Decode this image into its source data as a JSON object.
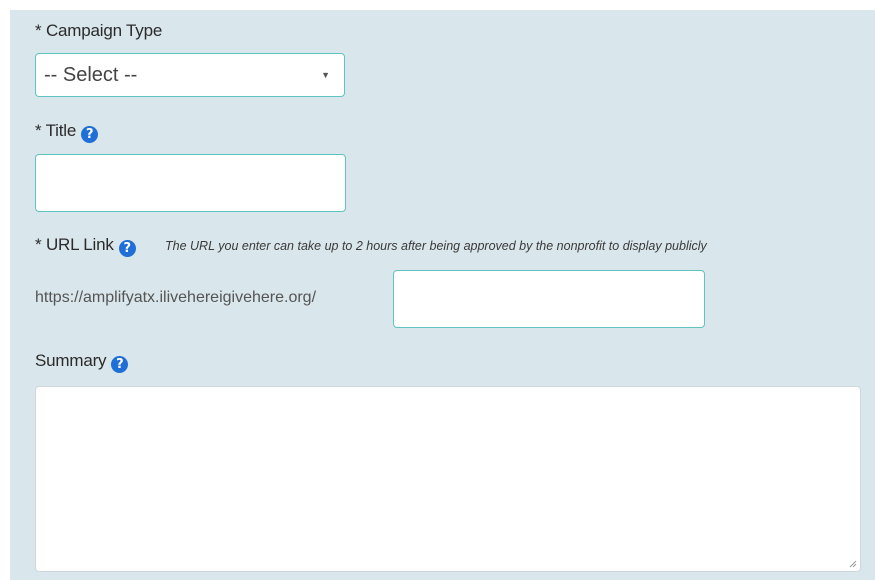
{
  "form": {
    "campaign_type": {
      "label": "* Campaign Type",
      "selected": "-- Select --"
    },
    "title": {
      "label": "* Title",
      "help_icon": "question-circle-icon",
      "help_glyph": "?",
      "value": ""
    },
    "url_link": {
      "label": "* URL Link",
      "help_icon": "question-circle-icon",
      "help_glyph": "?",
      "hint": "The URL you enter can take up to 2 hours after being approved by the nonprofit to display publicly",
      "prefix": "https://amplifyatx.ilivehereigivehere.org/",
      "value": ""
    },
    "summary": {
      "label": "Summary",
      "help_icon": "question-circle-icon",
      "help_glyph": "?",
      "value": ""
    }
  },
  "colors": {
    "panel_bg": "#d9e6eb",
    "input_border": "#5fc3c0",
    "help_icon": "#1f6fd6"
  }
}
